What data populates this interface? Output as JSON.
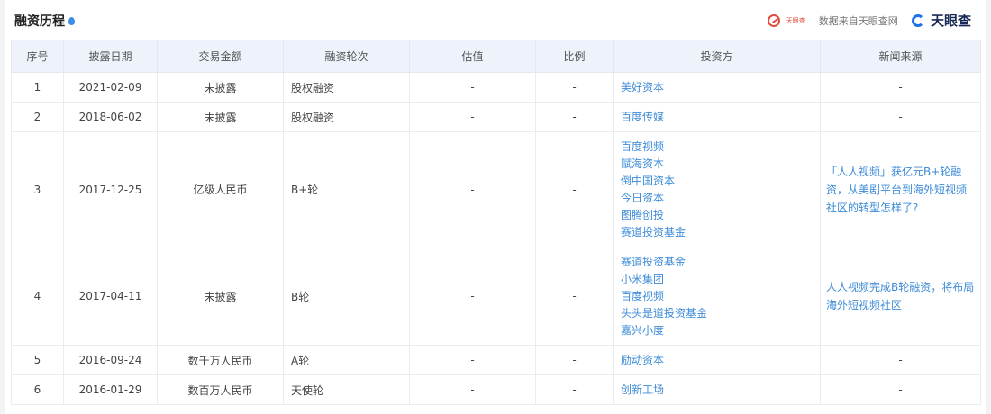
{
  "header": {
    "title": "融资历程",
    "stamp_text": "天眼查",
    "watermark_note": "数据来自天眼查网",
    "brand": "天眼查"
  },
  "table": {
    "columns": [
      "序号",
      "披露日期",
      "交易金额",
      "融资轮次",
      "估值",
      "比例",
      "投资方",
      "新闻来源"
    ],
    "rows": [
      {
        "no": "1",
        "date": "2021-02-09",
        "amount": "未披露",
        "round": "股权融资",
        "valuation": "-",
        "ratio": "-",
        "investors": [
          "美好资本"
        ],
        "news": "-"
      },
      {
        "no": "2",
        "date": "2018-06-02",
        "amount": "未披露",
        "round": "股权融资",
        "valuation": "-",
        "ratio": "-",
        "investors": [
          "百度传媒"
        ],
        "news": "-"
      },
      {
        "no": "3",
        "date": "2017-12-25",
        "amount": "亿级人民币",
        "round": "B+轮",
        "valuation": "-",
        "ratio": "-",
        "investors": [
          "百度视频",
          "赋海资本",
          "倒中国资本",
          "今日资本",
          "图腾创投",
          "赛道投资基金"
        ],
        "news": "「人人视频」获亿元B+轮融资，从美剧平台到海外短视频社区的转型怎样了?"
      },
      {
        "no": "4",
        "date": "2017-04-11",
        "amount": "未披露",
        "round": "B轮",
        "valuation": "-",
        "ratio": "-",
        "investors": [
          "赛道投资基金",
          "小米集团",
          "百度视频",
          "头头是道投资基金",
          "嘉兴小度"
        ],
        "news": "人人视频完成B轮融资，将布局海外短视频社区"
      },
      {
        "no": "5",
        "date": "2016-09-24",
        "amount": "数千万人民币",
        "round": "A轮",
        "valuation": "-",
        "ratio": "-",
        "investors": [
          "励动资本"
        ],
        "news": "-"
      },
      {
        "no": "6",
        "date": "2016-01-29",
        "amount": "数百万人民币",
        "round": "天使轮",
        "valuation": "-",
        "ratio": "-",
        "investors": [
          "创新工场"
        ],
        "news": "-"
      }
    ]
  }
}
